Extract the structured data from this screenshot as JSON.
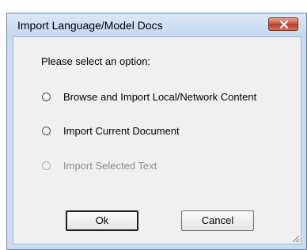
{
  "dialog": {
    "title": "Import Language/Model Docs",
    "prompt": "Please select an option:",
    "options": [
      {
        "label": "Browse and Import Local/Network Content",
        "selected": false,
        "enabled": true
      },
      {
        "label": "Import Current Document",
        "selected": false,
        "enabled": true
      },
      {
        "label": "Import Selected Text",
        "selected": false,
        "enabled": false
      }
    ],
    "ok_label": "Ok",
    "cancel_label": "Cancel"
  },
  "icons": {
    "close": "close-icon",
    "resize": "resize-grip-icon"
  },
  "colors": {
    "frame": "#c9dcf2",
    "close_button": "#c7513a",
    "client_background": "#f0f0f0",
    "disabled_text": "#8d8d8d"
  }
}
